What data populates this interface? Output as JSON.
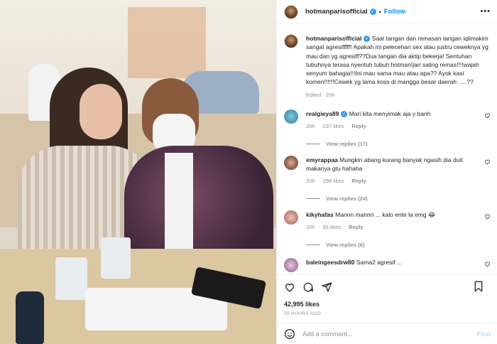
{
  "photo": {
    "alt": ""
  },
  "header": {
    "username": "hotmanparisofficial",
    "follow_label": "Follow",
    "more_glyph": "•••"
  },
  "caption": {
    "username": "hotmanparisofficial",
    "text": "Saat tangan dan remasan tangan iqlimakim sangat agresifffff! Apakah ini pelecehan sex atau justru ceweknya yg mau dan yg agresiff??Dua tangan dia aktip bekerja! Sentuhan tubuhnya terasa nyentuh tubuh hotman!jari saling remas!!!!wajah senyum bahagia!!!Ini mau sama mau atau apa?? Ayok kasi komen!!!!!!Cewek yg lama koss di mangga besar daerah .....??",
    "meta": "Edited · 20h"
  },
  "comments": [
    {
      "username": "realgieya89",
      "verified": true,
      "text": "Mari kita menyimak aja y banh",
      "time": "20h",
      "likes": "237 likes",
      "reply": "Reply",
      "view_replies": "View replies (17)",
      "avatar_color": "#4a9fbf"
    },
    {
      "username": "emyrappaa",
      "verified": false,
      "text": "Mungkin abang kurang banyak ngasih dia duit makanya gtu hahaha",
      "time": "20h",
      "likes": "298 likes",
      "reply": "Reply",
      "view_replies": "View replies (24)",
      "avatar_color": "#7a4b3a"
    },
    {
      "username": "kikyhafas",
      "verified": false,
      "text": "Mannn mannn ... kalo ente la emg 😂",
      "time": "20h",
      "likes": "85 likes",
      "reply": "Reply",
      "view_replies": "View replies (6)",
      "avatar_color": "#c4827c"
    },
    {
      "username": "baleingeesdrw80",
      "verified": false,
      "text": "Sama2 agresif ...",
      "time": "",
      "likes": "",
      "reply": "",
      "view_replies": "",
      "avatar_color": "#b98ab0"
    }
  ],
  "actions": {
    "likes": "42,995 likes",
    "date": "20 HOURS AGO"
  },
  "add_comment": {
    "placeholder": "Add a comment...",
    "post_label": "Post"
  },
  "colors": {
    "accent": "#0095f6",
    "verified": "#3897f0",
    "muted": "#8e8e8e"
  },
  "icons": [
    "heart-icon",
    "comment-icon",
    "share-icon",
    "bookmark-icon",
    "emoji-icon",
    "more-icon",
    "verified-icon"
  ]
}
